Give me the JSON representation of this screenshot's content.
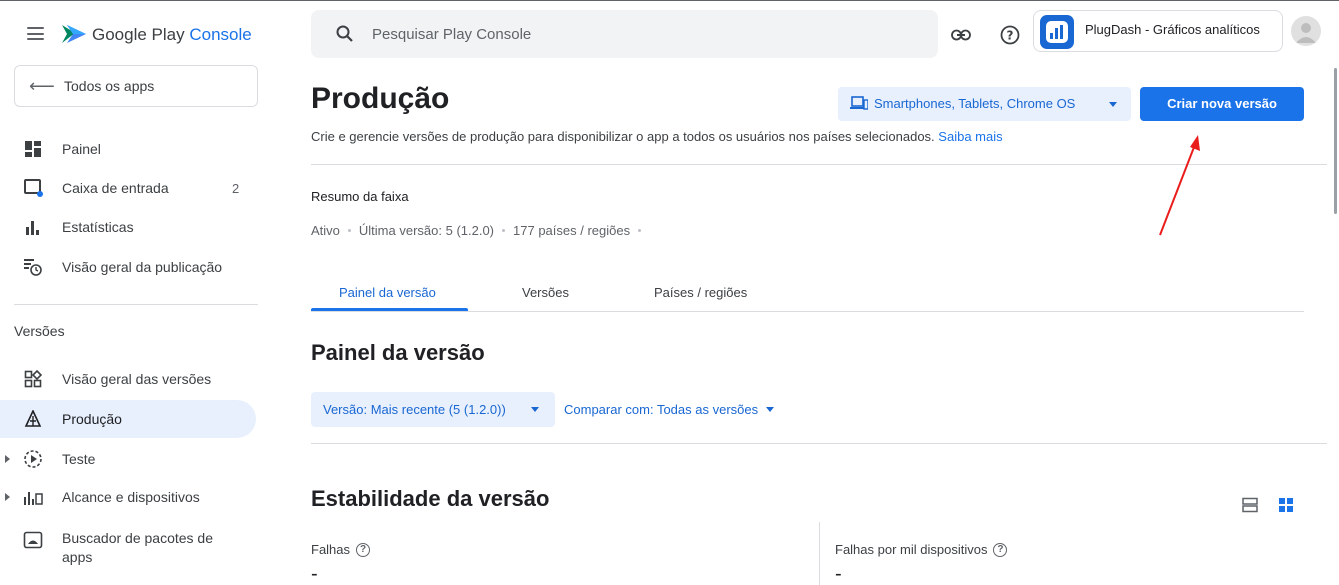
{
  "colors": {
    "accent": "#1a73e8",
    "accent_dark": "#1967d2",
    "active_bg": "#e8f0fe",
    "annotation": "#ea1d1d"
  },
  "brand": {
    "name_part1": "Google Play",
    "name_part2": "Console"
  },
  "sidebar": {
    "back_label": "Todos os apps",
    "items": [
      {
        "label": "Painel",
        "icon": "dashboard-icon"
      },
      {
        "label": "Caixa de entrada",
        "icon": "inbox-icon",
        "badge": "2"
      },
      {
        "label": "Estatísticas",
        "icon": "bar-chart-icon"
      },
      {
        "label": "Visão geral da publicação",
        "icon": "publishing-overview-icon"
      }
    ],
    "section_label": "Versões",
    "release_items": [
      {
        "label": "Visão geral das versões",
        "icon": "releases-overview-icon"
      },
      {
        "label": "Produção",
        "icon": "production-icon",
        "active": true
      },
      {
        "label": "Teste",
        "icon": "testing-icon"
      },
      {
        "label": "Alcance e dispositivos",
        "icon": "reach-devices-icon"
      },
      {
        "label": "Buscador de pacotes de apps",
        "icon": "bundle-explorer-icon"
      }
    ]
  },
  "header": {
    "search_placeholder": "Pesquisar Play Console",
    "app_name": "PlugDash - Gráficos analíticos"
  },
  "main": {
    "title": "Produção",
    "device_selector": "Smartphones, Tablets, Chrome OS",
    "primary_button": "Criar nova versão",
    "subtitle": "Crie e gerencie versões de produção para disponibilizar o app a todos os usuários nos países selecionados.",
    "learn_more": "Saiba mais",
    "track_summary_title": "Resumo da faixa",
    "track_status": "Ativo",
    "track_latest": "Última versão: 5 (1.2.0)",
    "track_countries": "177 países / regiões",
    "tabs": [
      "Painel da versão",
      "Versões",
      "Países / regiões"
    ],
    "dashboard_title": "Painel da versão",
    "version_filter": "Versão: Mais recente (5 (1.2.0))",
    "compare_filter": "Comparar com: Todas as versões",
    "stability_title": "Estabilidade da versão",
    "metrics": [
      {
        "label": "Falhas",
        "value": "-"
      },
      {
        "label": "Falhas por mil dispositivos",
        "value": "-"
      }
    ]
  }
}
